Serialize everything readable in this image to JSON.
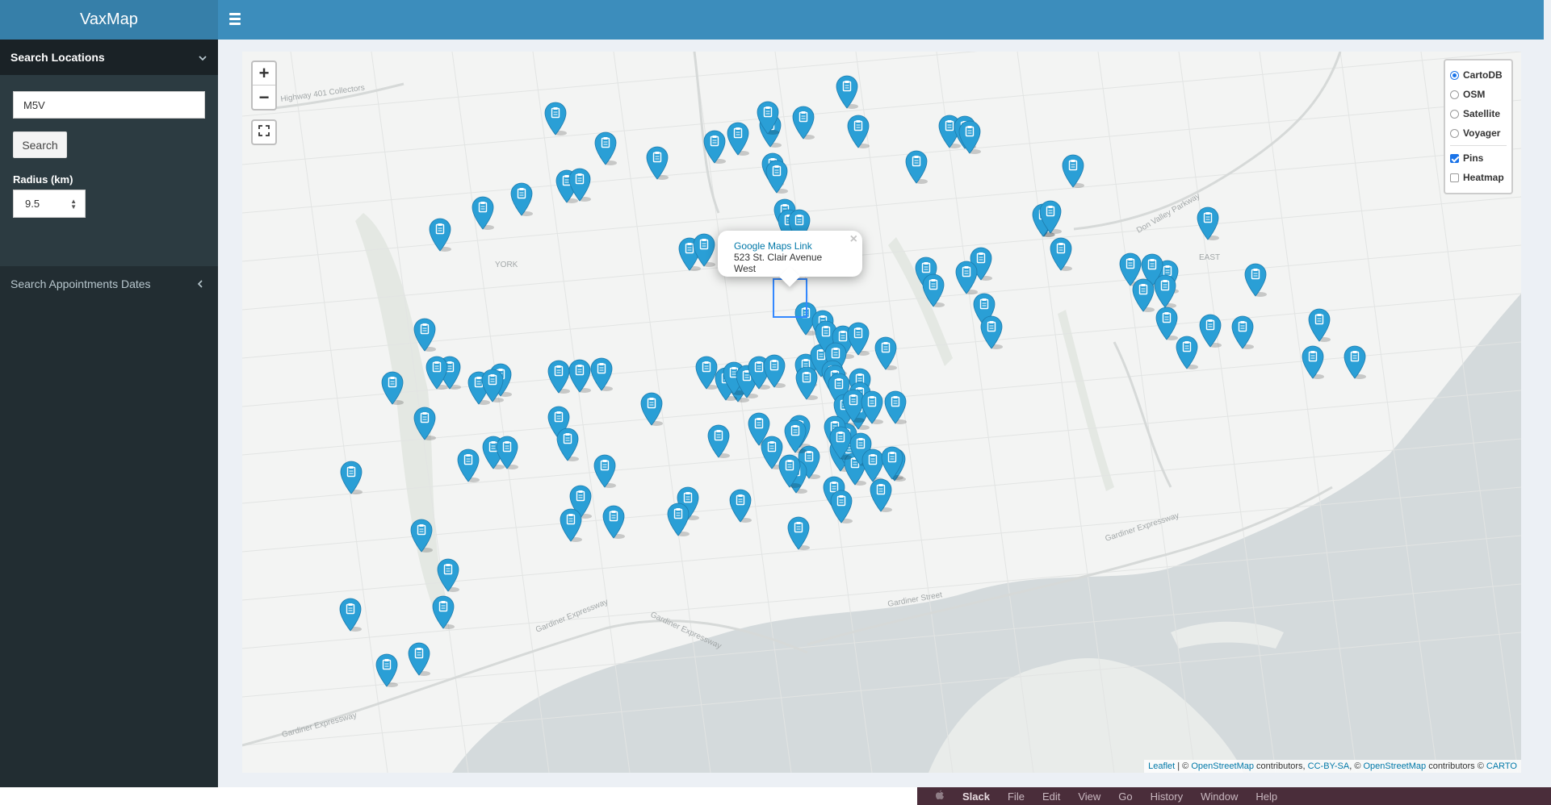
{
  "brand": {
    "title": "VaxMap"
  },
  "sidebar": {
    "search_section_label": "Search Locations",
    "search_input_value": "M5V",
    "search_button_label": "Search",
    "radius_label": "Radius (km)",
    "radius_value": "9.5",
    "appointments_label": "Search Appointments Dates"
  },
  "map": {
    "zoom_in": "+",
    "zoom_out": "−",
    "layers": [
      {
        "label": "CartoDB",
        "type": "radio",
        "checked": true
      },
      {
        "label": "OSM",
        "type": "radio",
        "checked": false
      },
      {
        "label": "Satellite",
        "type": "radio",
        "checked": false
      },
      {
        "label": "Voyager",
        "type": "radio",
        "checked": false
      },
      {
        "label": "Pins",
        "type": "checkbox",
        "checked": true
      },
      {
        "label": "Heatmap",
        "type": "checkbox",
        "checked": false
      }
    ],
    "popup": {
      "link_text": "Google Maps Link",
      "address": "523 St. Clair Avenue West",
      "close": "×"
    },
    "map_labels": [
      "Highway 401 Collectors",
      "YORK",
      "EAST",
      "Don Valley Parkway",
      "Gardiner Expressway",
      "Gardiner Expressway",
      "Gardiner Expressway",
      "Gardiner Expressway",
      "Gardiner Street"
    ],
    "attribution": {
      "leaflet": "Leaflet",
      "sep1": " | © ",
      "osm1": "OpenStreetMap",
      "contrib1": " contributors, ",
      "ccbysa": "CC-BY-SA",
      "sep2": ", © ",
      "osm2": "OpenStreetMap",
      "contrib2": " contributors © ",
      "carto": "CARTO"
    },
    "pin_color": "#2a9fd6",
    "pin_icon": "clipboard-icon"
  },
  "macbar": {
    "apple": "",
    "app": "Slack",
    "menus": [
      "File",
      "Edit",
      "View",
      "Go",
      "History",
      "Window",
      "Help"
    ]
  }
}
